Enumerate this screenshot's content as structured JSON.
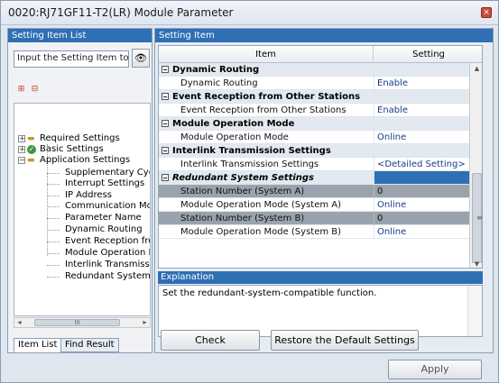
{
  "window": {
    "title": "0020:RJ71GF11-T2(LR) Module Parameter",
    "close_glyph": "×"
  },
  "left_panel": {
    "header": "Setting Item List",
    "search_value": "Input the Setting Item to Se",
    "search_icon_glyph": "🔍",
    "tree": [
      {
        "label": "Required Settings",
        "level": 1,
        "expander": "+",
        "icon": "folder-icon"
      },
      {
        "label": "Basic Settings",
        "level": 1,
        "expander": "+",
        "icon": "check-icon"
      },
      {
        "label": "Application Settings",
        "level": 1,
        "expander": "−",
        "icon": "folder-icon"
      },
      {
        "label": "Supplementary Cycli",
        "level": 2
      },
      {
        "label": "Interrupt Settings",
        "level": 2
      },
      {
        "label": "IP Address",
        "level": 2
      },
      {
        "label": "Communication Mode",
        "level": 2
      },
      {
        "label": "Parameter Name",
        "level": 2
      },
      {
        "label": "Dynamic Routing",
        "level": 2
      },
      {
        "label": "Event Reception fror",
        "level": 2
      },
      {
        "label": "Module Operation Mc",
        "level": 2
      },
      {
        "label": "Interlink Transmissio",
        "level": 2
      },
      {
        "label": "Redundant System S",
        "level": 2
      }
    ],
    "scroll_left": "◂",
    "scroll_right": "▸",
    "scroll_grip": "III",
    "tabs": [
      "Item List",
      "Find Result"
    ]
  },
  "right_panel": {
    "header": "Setting Item",
    "columns": {
      "item": "Item",
      "setting": "Setting"
    },
    "rows": [
      {
        "type": "category",
        "item": "Dynamic Routing",
        "setting": ""
      },
      {
        "type": "sub",
        "item": "Dynamic Routing",
        "setting": "Enable"
      },
      {
        "type": "category",
        "item": "Event Reception from Other Stations",
        "setting": ""
      },
      {
        "type": "sub",
        "item": "Event Reception from Other Stations",
        "setting": "Enable"
      },
      {
        "type": "category",
        "item": "Module Operation Mode",
        "setting": ""
      },
      {
        "type": "sub",
        "item": "Module Operation Mode",
        "setting": "Online"
      },
      {
        "type": "category",
        "item": "Interlink Transmission Settings",
        "setting": ""
      },
      {
        "type": "sub",
        "item": "Interlink Transmission Settings",
        "setting": "<Detailed Setting>"
      },
      {
        "type": "category-italic",
        "item": "Redundant System Settings",
        "setting": ""
      },
      {
        "type": "gray",
        "item": "Station Number (System A)",
        "setting": "0"
      },
      {
        "type": "sub",
        "item": "Module Operation Mode (System A)",
        "setting": "Online"
      },
      {
        "type": "gray",
        "item": "Station Number (System B)",
        "setting": "0"
      },
      {
        "type": "sub",
        "item": "Module Operation Mode (System B)",
        "setting": "Online"
      }
    ],
    "scroll_up": "▲",
    "scroll_down": "▼",
    "scroll_grip": "≡",
    "explanation_header": "Explanation",
    "explanation_text": "Set the redundant-system-compatible function.",
    "buttons": {
      "check": "Check",
      "restore": "Restore the Default Settings"
    }
  },
  "footer": {
    "apply": "Apply"
  },
  "colors": {
    "accent": "#2f6fb4",
    "value_text": "#1a3a8a",
    "disabled_gray": "#9aa3ad"
  }
}
